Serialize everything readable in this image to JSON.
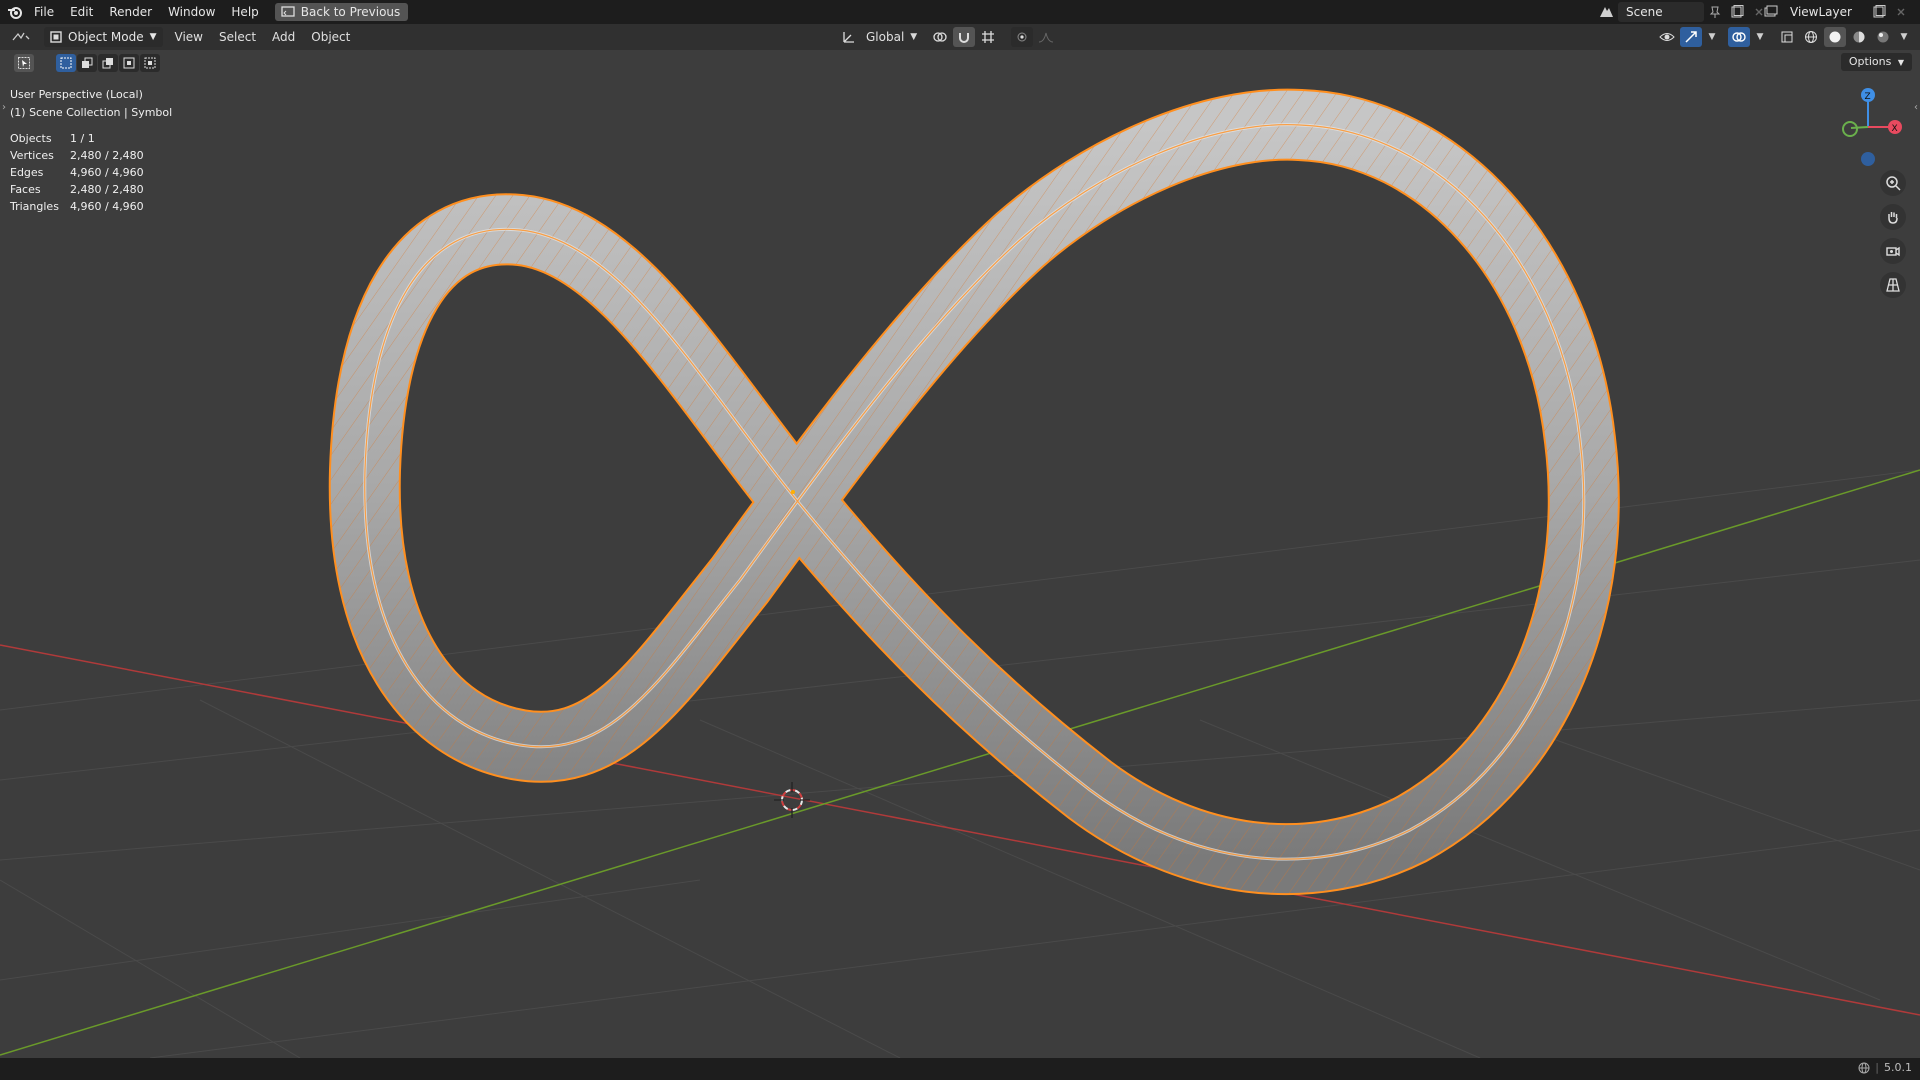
{
  "menu": {
    "file": "File",
    "edit": "Edit",
    "render": "Render",
    "window": "Window",
    "help": "Help",
    "back_to_previous": "Back to Previous"
  },
  "scene": {
    "name": "Scene"
  },
  "view_layer": {
    "name": "ViewLayer"
  },
  "header": {
    "mode": "Object Mode",
    "view": "View",
    "select": "Select",
    "add": "Add",
    "object": "Object",
    "orientation": "Global"
  },
  "viewport_info": {
    "perspective": "User Perspective (Local)",
    "collection": "(1) Scene Collection | Symbol"
  },
  "stats": [
    {
      "label": "Objects",
      "value": "1 / 1"
    },
    {
      "label": "Vertices",
      "value": "2,480 / 2,480"
    },
    {
      "label": "Edges",
      "value": "4,960 / 4,960"
    },
    {
      "label": "Faces",
      "value": "2,480 / 2,480"
    },
    {
      "label": "Triangles",
      "value": "4,960 / 4,960"
    }
  ],
  "options": "Options",
  "gizmo": {
    "z": "Z",
    "x": "X"
  },
  "colors": {
    "selection": "#ff8f1f",
    "x_axis": "#b03a3a",
    "y_axis": "#6a9a2a",
    "gizmo_x": "#e84a5f",
    "gizmo_y": "#6ab04c",
    "gizmo_z": "#3f8fe6"
  },
  "version": "5.0.1"
}
